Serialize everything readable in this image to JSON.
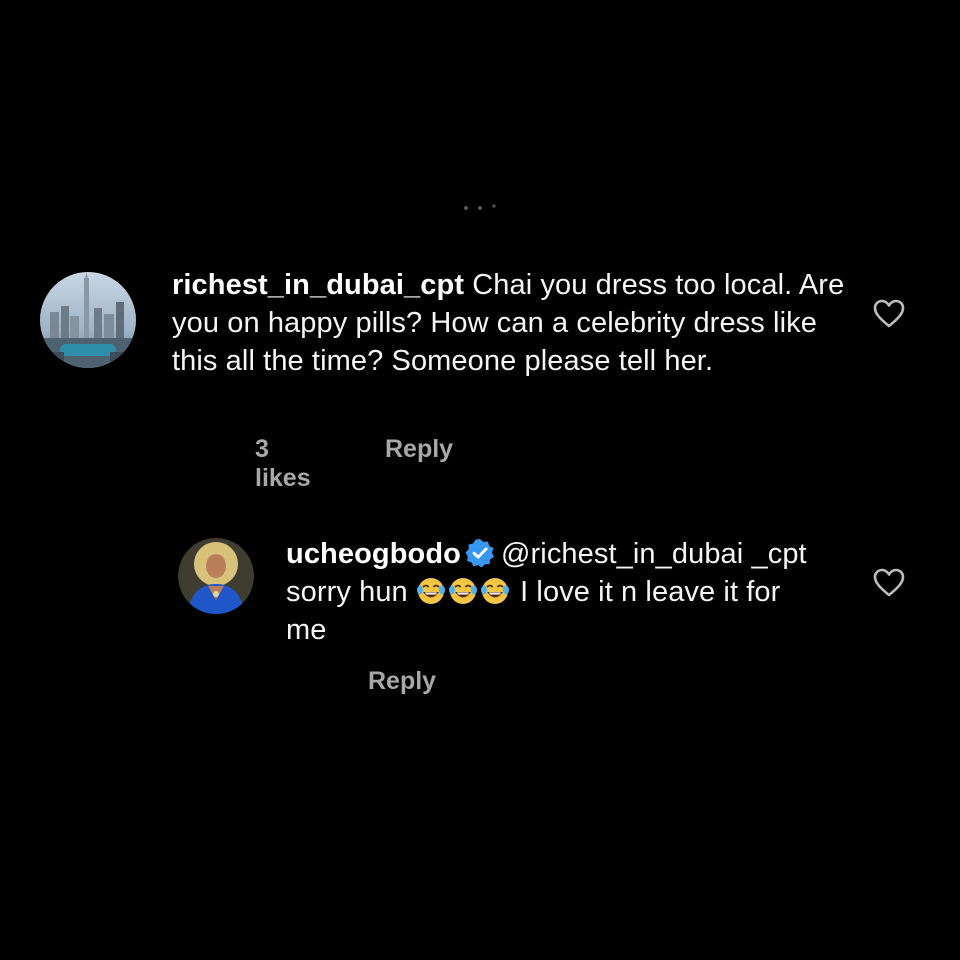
{
  "comments": [
    {
      "username": "richest_in_dubai_cpt",
      "text": " Chai you dress too local. Are you on happy pills? How can a celebrity dress like this all the time?  Someone please tell her.",
      "likes": "3 likes",
      "reply_label": "Reply",
      "avatar_icon": "city-skyline-avatar",
      "heart_icon": "heart-outline-icon"
    },
    {
      "username": "ucheogbodo",
      "verified": true,
      "mention": "@richest_in_dubai",
      "text_part1": "_cpt sorry hun ",
      "emoji": "😂",
      "emoji_count": 3,
      "text_part2": " I love it n leave it for me",
      "reply_label": "Reply",
      "avatar_icon": "person-blue-outfit-avatar",
      "heart_icon": "heart-outline-icon"
    }
  ],
  "colors": {
    "background": "#000000",
    "text": "#f5f5f5",
    "meta": "#a8a8a8",
    "verified": "#3897f0"
  }
}
